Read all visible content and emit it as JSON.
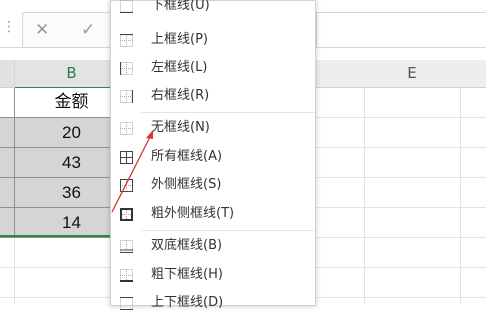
{
  "formula_bar": {
    "handle_icon": "drag-handle-icon",
    "cancel_glyph": "✕",
    "confirm_glyph": "✓"
  },
  "columns": {
    "b": "B",
    "e": "E"
  },
  "table": {
    "header": "金额",
    "values": [
      "20",
      "43",
      "36",
      "14"
    ]
  },
  "menu": {
    "items": [
      {
        "label": "下框线(U)",
        "icon": "border-bottom-icon"
      },
      {
        "label": "上框线(P)",
        "icon": "border-top-icon"
      },
      {
        "label": "左框线(L)",
        "icon": "border-left-icon"
      },
      {
        "label": "右框线(R)",
        "icon": "border-right-icon"
      },
      {
        "label": "无框线(N)",
        "icon": "no-border-icon"
      },
      {
        "label": "所有框线(A)",
        "icon": "all-borders-icon"
      },
      {
        "label": "外侧框线(S)",
        "icon": "outside-borders-icon"
      },
      {
        "label": "粗外侧框线(T)",
        "icon": "thick-outside-borders-icon"
      },
      {
        "label": "双底框线(B)",
        "icon": "double-bottom-border-icon"
      },
      {
        "label": "粗下框线(H)",
        "icon": "thick-bottom-border-icon"
      },
      {
        "label": "上下框线(D)",
        "icon": "top-bottom-border-icon"
      }
    ]
  },
  "colors": {
    "selection_green": "#2a8a4e",
    "arrow_red": "#e0312b",
    "selected_fill": "#d5d5d5"
  }
}
